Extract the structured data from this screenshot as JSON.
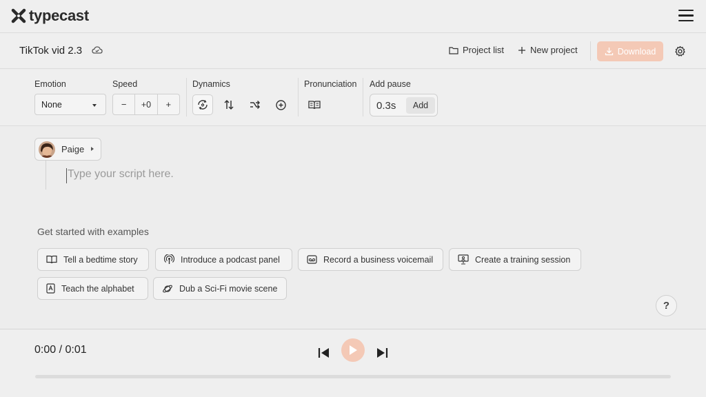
{
  "header": {
    "logo_text": "typecast",
    "menu_icon": "hamburger-icon"
  },
  "project": {
    "title": "TikTok vid 2.3",
    "project_list_label": "Project list",
    "new_project_label": "New project",
    "download_label": "Download"
  },
  "toolbar": {
    "emotion_label": "Emotion",
    "emotion_value": "None",
    "speed_label": "Speed",
    "speed_minus": "−",
    "speed_value": "+0",
    "speed_plus": "+",
    "dynamics_label": "Dynamics",
    "pronunciation_label": "Pronunciation",
    "pause_label": "Add pause",
    "pause_value": "0.3s",
    "pause_add": "Add"
  },
  "editor": {
    "speaker_name": "Paige",
    "script_placeholder": "Type your script here."
  },
  "examples": {
    "title": "Get started with examples",
    "items": [
      {
        "label": "Tell a bedtime story",
        "icon": "book-icon"
      },
      {
        "label": "Introduce a podcast panel",
        "icon": "podcast-icon"
      },
      {
        "label": "Record a business voicemail",
        "icon": "voicemail-icon"
      },
      {
        "label": "Create a training session",
        "icon": "presentation-icon"
      },
      {
        "label": "Teach the alphabet",
        "icon": "letter-card-icon"
      },
      {
        "label": "Dub a Sci-Fi movie scene",
        "icon": "planet-icon"
      }
    ]
  },
  "help": {
    "label": "?"
  },
  "player": {
    "time": "0:00 / 0:01",
    "progress": 0
  },
  "colors": {
    "accent": "#f4c9b6",
    "background": "#efefef"
  }
}
